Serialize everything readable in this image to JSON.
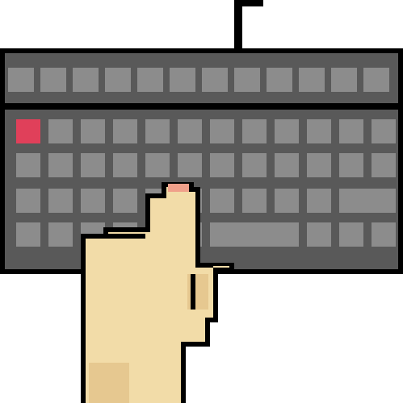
{
  "illustration": {
    "subject": "pixel-art-keyboard-with-hand",
    "colors": {
      "background": "#ffffff",
      "outline": "#000000",
      "keyboard_body": "#595959",
      "key": "#8c8c8c",
      "accent_key": "#e0405a",
      "skin": "#f2dca8",
      "skin_shadow": "#e6c890",
      "nail": "#f0a08a"
    },
    "keyboard": {
      "rows": [
        {
          "keys": 12,
          "row": "function"
        },
        {
          "keys": 12,
          "row": "number"
        },
        {
          "keys": 12,
          "row": "top"
        },
        {
          "keys": 11,
          "row": "home"
        },
        {
          "keys": 8,
          "row": "bottom"
        }
      ],
      "accent_key_name": "escape-key"
    },
    "hand": {
      "gesture": "pressing-key",
      "icon": "hand-icon"
    }
  }
}
